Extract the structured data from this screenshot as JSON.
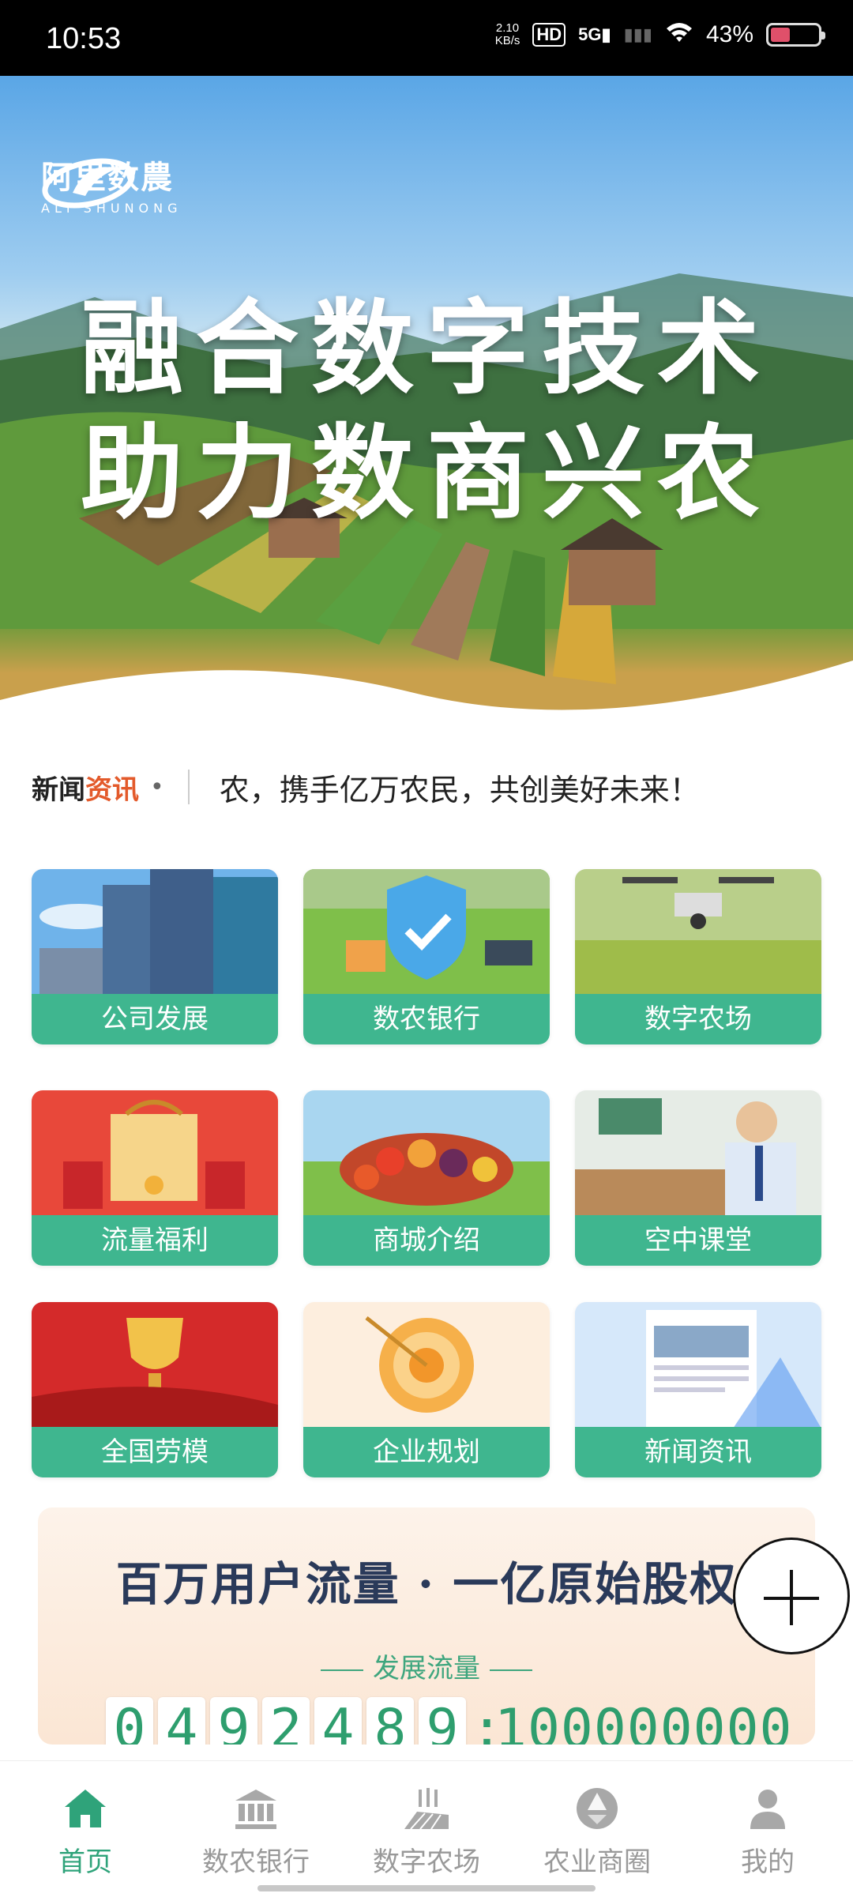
{
  "status_bar": {
    "time": "10:53",
    "net_speed": "2.10",
    "net_unit": "KB/s",
    "hd": "HD",
    "signal": "5G",
    "battery": "43%"
  },
  "hero": {
    "logo_cn": "阿里数農",
    "logo_en": "ALI SHUNONG",
    "line1": "融合数字技术",
    "line2": "助力数商兴农"
  },
  "news": {
    "tag_prefix": "新闻",
    "tag_highlight": "资讯",
    "ticker_text": "农，携手亿万农民，共创美好未来！"
  },
  "grid_items": [
    {
      "label": "公司发展",
      "icon": "building-icon"
    },
    {
      "label": "数农银行",
      "icon": "shield-bank-icon"
    },
    {
      "label": "数字农场",
      "icon": "drone-farm-icon"
    },
    {
      "label": "流量福利",
      "icon": "gift-bag-icon"
    },
    {
      "label": "商城介绍",
      "icon": "produce-basket-icon"
    },
    {
      "label": "空中课堂",
      "icon": "classroom-icon"
    },
    {
      "label": "全国劳模",
      "icon": "trophy-icon"
    },
    {
      "label": "企业规划",
      "icon": "target-icon"
    },
    {
      "label": "新闻资讯",
      "icon": "newspaper-icon"
    }
  ],
  "banner": {
    "title": "百万用户流量 · 一亿原始股权",
    "subtitle": "发展流量",
    "counter_digits": [
      "0",
      "4",
      "9",
      "2",
      "4",
      "8",
      "9"
    ],
    "counter_colon": ":",
    "counter_total": "100000000"
  },
  "nav": [
    {
      "label": "首页",
      "icon": "home-icon",
      "active": true
    },
    {
      "label": "数农银行",
      "icon": "bank-icon",
      "active": false
    },
    {
      "label": "数字农场",
      "icon": "farm-field-icon",
      "active": false
    },
    {
      "label": "农业商圈",
      "icon": "aperture-icon",
      "active": false
    },
    {
      "label": "我的",
      "icon": "person-icon",
      "active": false
    }
  ],
  "colors": {
    "accent_green": "#3fb68f",
    "nav_active": "#2fa37a",
    "news_highlight": "#e35a2b"
  }
}
